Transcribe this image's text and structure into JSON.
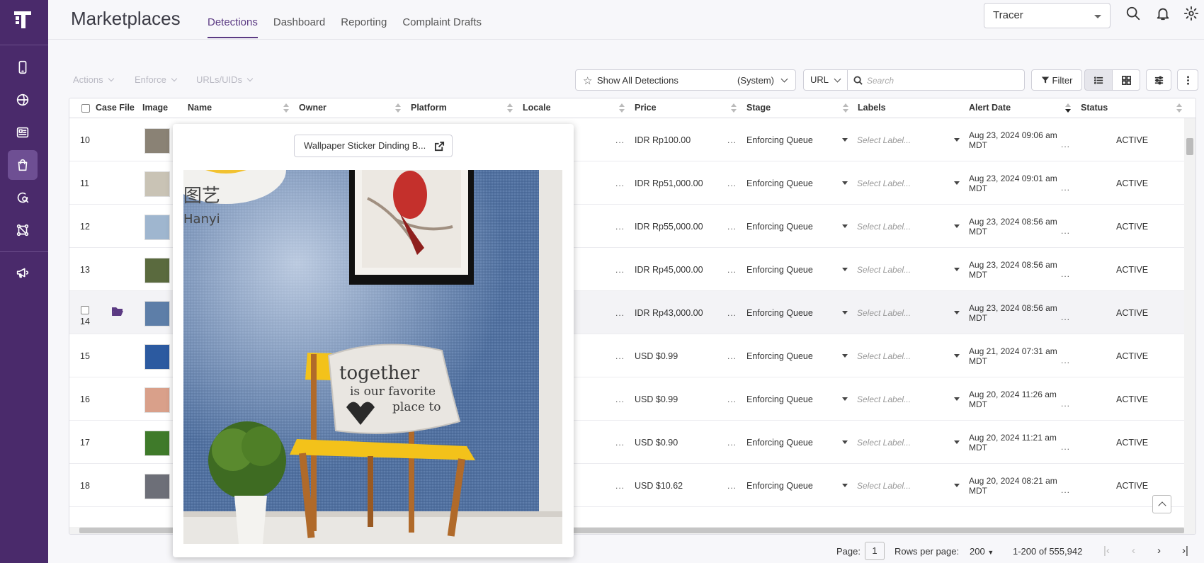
{
  "header": {
    "title": "Marketplaces",
    "tabs": [
      {
        "label": "Detections",
        "active": true
      },
      {
        "label": "Dashboard"
      },
      {
        "label": "Reporting"
      },
      {
        "label": "Complaint Drafts"
      }
    ],
    "workspace_select": "Tracer"
  },
  "toolbar": {
    "actions": "Actions",
    "enforce": "Enforce",
    "urls": "URLs/UIDs",
    "view_label": "Show All Detections",
    "view_type": "(System)",
    "search_field": "URL",
    "search_placeholder": "Search",
    "filter_label": "Filter"
  },
  "table": {
    "columns": [
      "Case File",
      "Image",
      "Name",
      "Owner",
      "Platform",
      "Locale",
      "Price",
      "Stage",
      "Labels",
      "Alert Date",
      "Status"
    ],
    "label_placeholder": "Select Label...",
    "rows": [
      {
        "id": "10",
        "price": "IDR Rp100.00",
        "stage": "Enforcing Queue",
        "date1": "Aug 23, 2024 09:06 am",
        "date2": "MDT",
        "status": "ACTIVE",
        "thumb": "#8a8275"
      },
      {
        "id": "11",
        "price": "IDR Rp51,000.00",
        "stage": "Enforcing Queue",
        "date1": "Aug 23, 2024 09:01 am",
        "date2": "MDT",
        "status": "ACTIVE",
        "thumb": "#c9c3b5"
      },
      {
        "id": "12",
        "price": "IDR Rp55,000.00",
        "stage": "Enforcing Queue",
        "date1": "Aug 23, 2024 08:56 am",
        "date2": "MDT",
        "status": "ACTIVE",
        "thumb": "#9fb6cf"
      },
      {
        "id": "13",
        "price": "IDR Rp45,000.00",
        "stage": "Enforcing Queue",
        "date1": "Aug 23, 2024 08:56 am",
        "date2": "MDT",
        "status": "ACTIVE",
        "thumb": "#5a6a3e"
      },
      {
        "id": "14",
        "price": "IDR Rp43,000.00",
        "stage": "Enforcing Queue",
        "date1": "Aug 23, 2024 08:56 am",
        "date2": "MDT",
        "status": "ACTIVE",
        "thumb": "#5d7ea8",
        "highlight": true
      },
      {
        "id": "15",
        "price": "USD $0.99",
        "stage": "Enforcing Queue",
        "date1": "Aug 21, 2024 07:31 am",
        "date2": "MDT",
        "status": "ACTIVE",
        "thumb": "#2c5aa0"
      },
      {
        "id": "16",
        "price": "USD $0.99",
        "stage": "Enforcing Queue",
        "date1": "Aug 20, 2024 11:26 am",
        "date2": "MDT",
        "status": "ACTIVE",
        "thumb": "#d9a08a"
      },
      {
        "id": "17",
        "price": "USD $0.90",
        "stage": "Enforcing Queue",
        "date1": "Aug 20, 2024 11:21 am",
        "date2": "MDT",
        "status": "ACTIVE",
        "thumb": "#3f7a2a"
      },
      {
        "id": "18",
        "price": "USD $10.62",
        "stage": "Enforcing Queue",
        "date1": "Aug 20, 2024 08:21 am",
        "date2": "MDT",
        "status": "ACTIVE",
        "thumb": "#6d6f78"
      }
    ]
  },
  "popover": {
    "link_text": "Wallpaper Sticker Dinding B...",
    "watermark_line1": "图艺",
    "watermark_line2": "Hanyi",
    "pillow_line1": "together",
    "pillow_line2": "is our favorite",
    "pillow_line3": "place to"
  },
  "footer": {
    "page_label": "Page:",
    "page_value": "1",
    "rows_label": "Rows per page:",
    "rows_value": "200",
    "range": "1-200 of 555,942"
  },
  "colors": {
    "sidebar": "#4a2a6b",
    "accent": "#5b3a83",
    "folder": "#5b3a83"
  }
}
